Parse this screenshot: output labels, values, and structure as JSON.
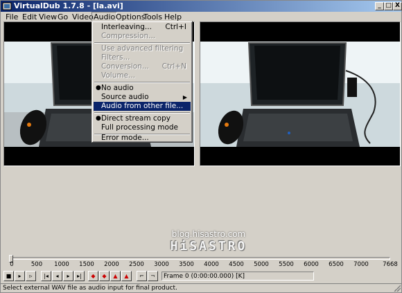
{
  "window": {
    "title": "VirtualDub 1.7.8 - [la.avi]",
    "icon": "virtualdub-app-icon",
    "controls": [
      "_",
      "□",
      "X"
    ]
  },
  "menubar": {
    "items": [
      "File",
      "Edit",
      "View",
      "Go",
      "Video",
      "Audio",
      "Options",
      "Tools",
      "Help"
    ],
    "active": "Audio"
  },
  "audio_menu": {
    "interleaving": {
      "label": "Interleaving...",
      "accel": "Ctrl+I"
    },
    "compression": {
      "label": "Compression..."
    },
    "use_advanced": {
      "label": "Use advanced filtering"
    },
    "filters": {
      "label": "Filters..."
    },
    "conversion": {
      "label": "Conversion...",
      "accel": "Ctrl+N"
    },
    "volume": {
      "label": "Volume..."
    },
    "no_audio": {
      "label": "No audio",
      "checked": true
    },
    "source_audio": {
      "label": "Source audio",
      "submenu": true
    },
    "audio_from_other_file": {
      "label": "Audio from other file...",
      "highlighted": true
    },
    "direct_stream_copy": {
      "label": "Direct stream copy",
      "checked": true
    },
    "full_processing": {
      "label": "Full processing mode"
    },
    "error_mode": {
      "label": "Error mode..."
    }
  },
  "watermark": {
    "url": "blog.hisastro.com",
    "logo": "HiSASTRO"
  },
  "timeline": {
    "position_fraction": 0.0,
    "ticks": [
      "0",
      "500",
      "1000",
      "1500",
      "2000",
      "2500",
      "3000",
      "3500",
      "4000",
      "4500",
      "5000",
      "5500",
      "6000",
      "6500",
      "7000",
      "7668"
    ]
  },
  "frame_indicator": "Frame 0 (0:00:00.000) [K]",
  "status": "Select external WAV file as audio input for final product."
}
